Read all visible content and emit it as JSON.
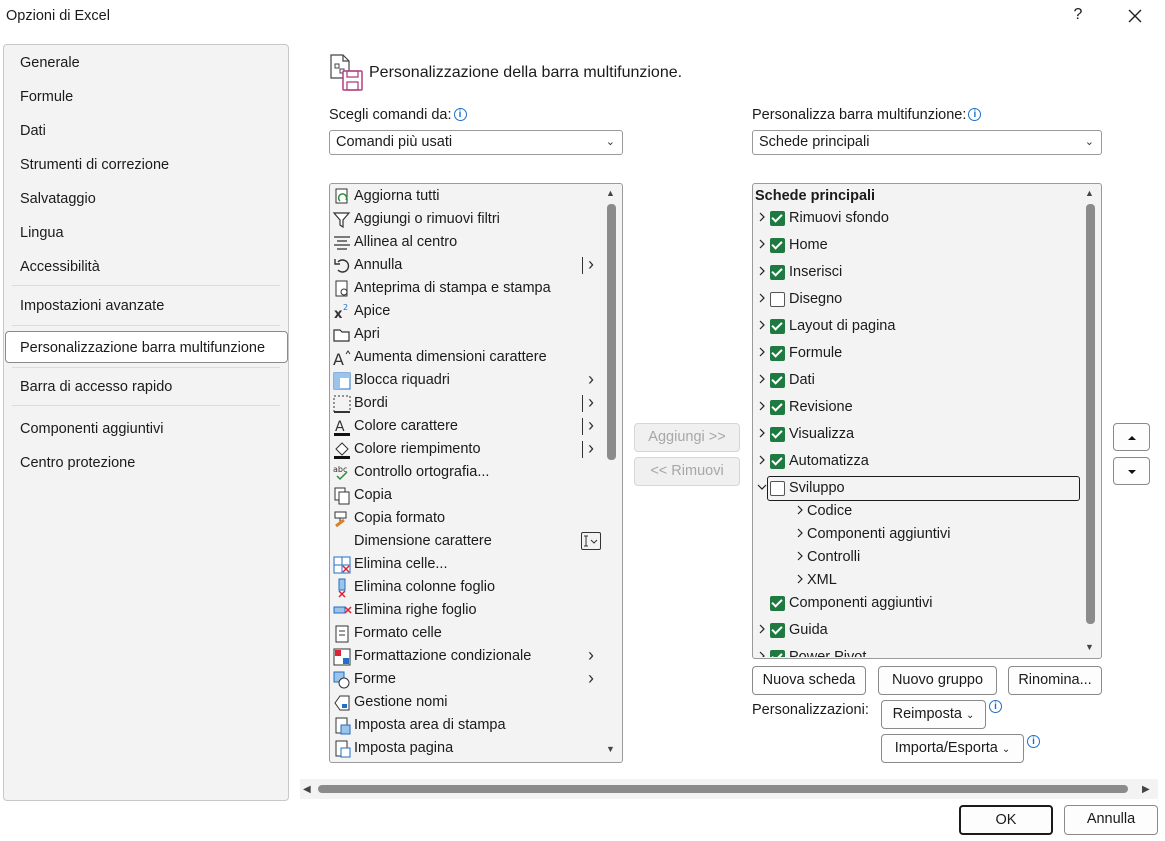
{
  "window": {
    "title": "Opzioni di Excel",
    "help": "?"
  },
  "nav": {
    "items": [
      "Generale",
      "Formule",
      "Dati",
      "Strumenti di correzione",
      "Salvataggio",
      "Lingua",
      "Accessibilità",
      "Impostazioni avanzate",
      "Personalizzazione barra multifunzione",
      "Barra di accesso rapido",
      "Componenti aggiuntivi",
      "Centro protezione"
    ],
    "selected": "Personalizzazione barra multifunzione"
  },
  "header": {
    "title": "Personalizzazione della barra multifunzione."
  },
  "left": {
    "choose_label": "Scegli comandi da:",
    "choose_value": "Comandi più usati",
    "commands": [
      {
        "label": "Aggiorna tutti",
        "icon": "refresh-all-icon"
      },
      {
        "label": "Aggiungi o rimuovi filtri",
        "icon": "filter-icon"
      },
      {
        "label": "Allinea al centro",
        "icon": "align-center-icon"
      },
      {
        "label": "Annulla",
        "icon": "undo-icon",
        "split": true
      },
      {
        "label": "Anteprima di stampa e stampa",
        "icon": "print-preview-icon"
      },
      {
        "label": "Apice",
        "icon": "superscript-icon"
      },
      {
        "label": "Apri",
        "icon": "open-folder-icon"
      },
      {
        "label": "Aumenta dimensioni carattere",
        "icon": "grow-font-icon"
      },
      {
        "label": "Blocca riquadri",
        "icon": "freeze-panes-icon",
        "arrow": true
      },
      {
        "label": "Bordi",
        "icon": "borders-icon",
        "split": true
      },
      {
        "label": "Colore carattere",
        "icon": "font-color-icon",
        "split": true
      },
      {
        "label": "Colore riempimento",
        "icon": "fill-color-icon",
        "split": true
      },
      {
        "label": "Controllo ortografia...",
        "icon": "spelling-icon"
      },
      {
        "label": "Copia",
        "icon": "copy-icon"
      },
      {
        "label": "Copia formato",
        "icon": "format-painter-icon"
      },
      {
        "label": "Dimensione carattere",
        "icon": "",
        "combo": true
      },
      {
        "label": "Elimina celle...",
        "icon": "delete-cells-icon"
      },
      {
        "label": "Elimina colonne foglio",
        "icon": "delete-columns-icon"
      },
      {
        "label": "Elimina righe foglio",
        "icon": "delete-rows-icon"
      },
      {
        "label": "Formato celle",
        "icon": "format-cells-icon"
      },
      {
        "label": "Formattazione condizionale",
        "icon": "conditional-formatting-icon",
        "arrow": true
      },
      {
        "label": "Forme",
        "icon": "shapes-icon",
        "arrow": true
      },
      {
        "label": "Gestione nomi",
        "icon": "name-manager-icon"
      },
      {
        "label": "Imposta area di stampa",
        "icon": "print-area-icon"
      },
      {
        "label": "Imposta pagina",
        "icon": "page-setup-icon"
      }
    ]
  },
  "middle": {
    "add_label": "Aggiungi >>",
    "remove_label": "<< Rimuovi"
  },
  "right": {
    "customize_label": "Personalizza barra multifunzione:",
    "customize_value": "Schede principali",
    "tree_header": "Schede principali",
    "tabs": [
      {
        "label": "Rimuovi sfondo",
        "checked": true,
        "expand": "collapsed",
        "level": 0
      },
      {
        "label": "Home",
        "checked": true,
        "expand": "collapsed",
        "level": 0
      },
      {
        "label": "Inserisci",
        "checked": true,
        "expand": "collapsed",
        "level": 0
      },
      {
        "label": "Disegno",
        "checked": false,
        "expand": "collapsed",
        "level": 0
      },
      {
        "label": "Layout di pagina",
        "checked": true,
        "expand": "collapsed",
        "level": 0
      },
      {
        "label": "Formule",
        "checked": true,
        "expand": "collapsed",
        "level": 0
      },
      {
        "label": "Dati",
        "checked": true,
        "expand": "collapsed",
        "level": 0
      },
      {
        "label": "Revisione",
        "checked": true,
        "expand": "collapsed",
        "level": 0
      },
      {
        "label": "Visualizza",
        "checked": true,
        "expand": "collapsed",
        "level": 0
      },
      {
        "label": "Automatizza",
        "checked": true,
        "expand": "collapsed",
        "level": 0
      },
      {
        "label": "Sviluppo",
        "checked": false,
        "expand": "expanded",
        "level": 0,
        "focused": true
      },
      {
        "label": "Codice",
        "expand": "collapsed",
        "level": 1
      },
      {
        "label": "Componenti aggiuntivi",
        "expand": "collapsed",
        "level": 1
      },
      {
        "label": "Controlli",
        "expand": "collapsed",
        "level": 1
      },
      {
        "label": "XML",
        "expand": "collapsed",
        "level": 1
      },
      {
        "label": "Componenti aggiuntivi",
        "checked": true,
        "expand": "none",
        "level": 0
      },
      {
        "label": "Guida",
        "checked": true,
        "expand": "collapsed",
        "level": 0
      },
      {
        "label": "Power Pivot",
        "checked": true,
        "expand": "collapsed",
        "level": 0,
        "clipped": true
      }
    ],
    "new_tab": "Nuova scheda",
    "new_group": "Nuovo gruppo",
    "rename": "Rinomina...",
    "customizations_label": "Personalizzazioni:",
    "reset": "Reimposta",
    "import_export": "Importa/Esporta"
  },
  "footer": {
    "ok": "OK",
    "cancel": "Annulla"
  },
  "colors": {
    "check_green": "#1f7a42",
    "info_blue": "#1f6fc5"
  }
}
